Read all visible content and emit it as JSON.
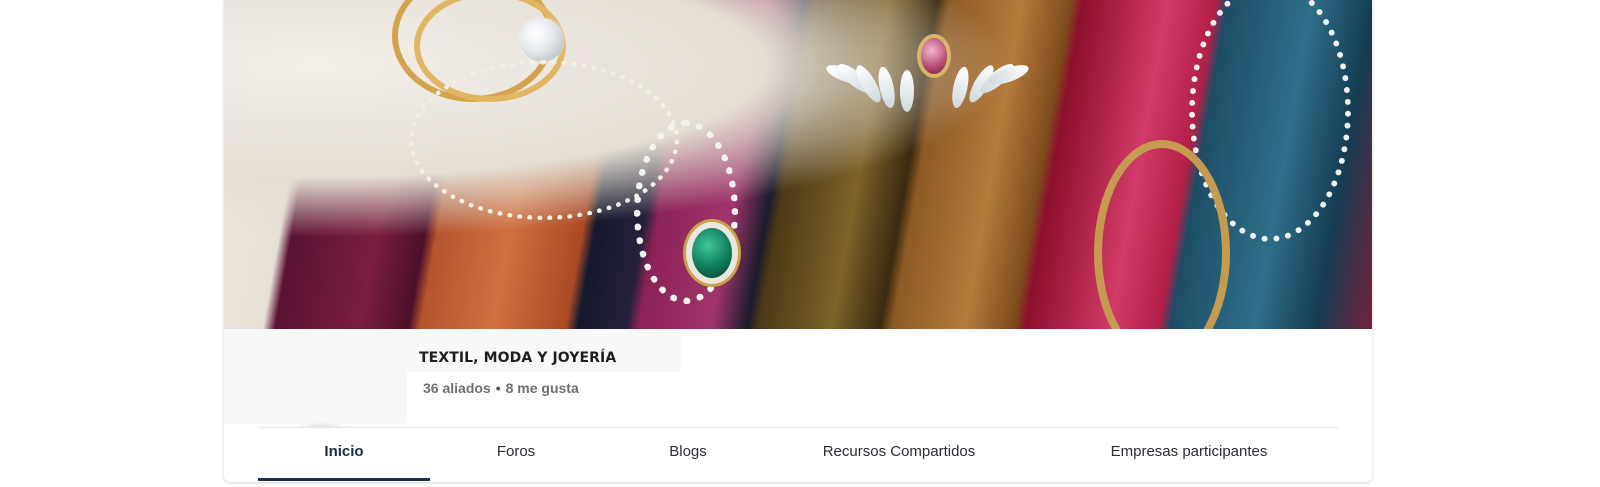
{
  "banner": {
    "description_icon": "cover-photo"
  },
  "group": {
    "title": "TEXTIL, MODA Y JOYERÍA",
    "allies": "36 aliados",
    "separator": "•",
    "likes": "8 me gusta"
  },
  "tabs": [
    {
      "label": "Inicio",
      "active": true
    },
    {
      "label": "Foros",
      "active": false
    },
    {
      "label": "Blogs",
      "active": false
    },
    {
      "label": "Recursos Compartidos",
      "active": false
    },
    {
      "label": "Empresas participantes",
      "active": false
    }
  ],
  "colors": {
    "active_tab_underline": "#1c3152",
    "title_text": "#1c1e21",
    "stats_text": "#6f6f6f"
  }
}
